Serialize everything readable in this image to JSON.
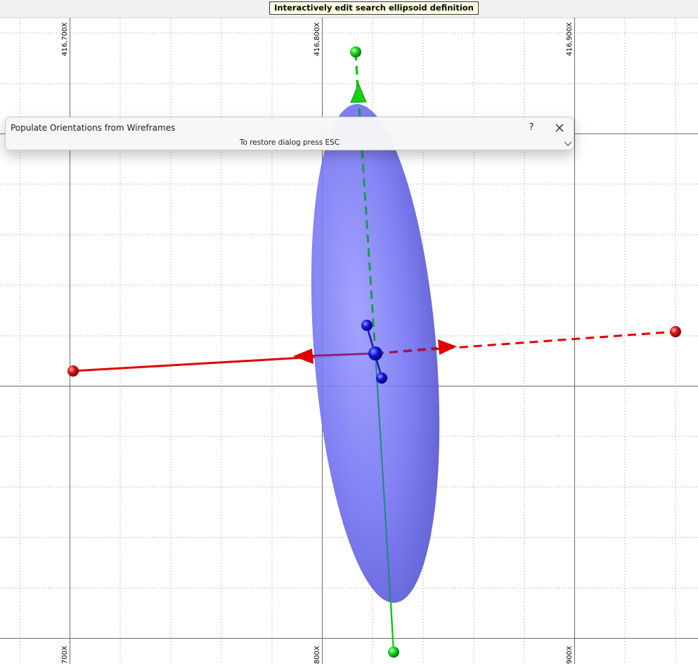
{
  "mode_banner": "Interactively edit search ellipsoid definition",
  "axis_labels_top": [
    "416,700X",
    "416,800X",
    "416,900X"
  ],
  "axis_labels_bottom": [
    "700X",
    "800X",
    "900X"
  ],
  "dialog": {
    "title": "Populate Orientations from Wireframes",
    "help_label": "?",
    "hint": "To restore dialog press ESC"
  },
  "colors": {
    "ellipsoid": "#6a6af5",
    "major_axis": "#00d000",
    "semi_axis": "#e00000",
    "minor_axis": "#0000cc",
    "grid_major": "#6b6b6b",
    "grid_minor": "#9a9a9a"
  },
  "icons": {
    "close": "close-icon",
    "expand": "chevron-down-icon",
    "help": "help-icon"
  }
}
